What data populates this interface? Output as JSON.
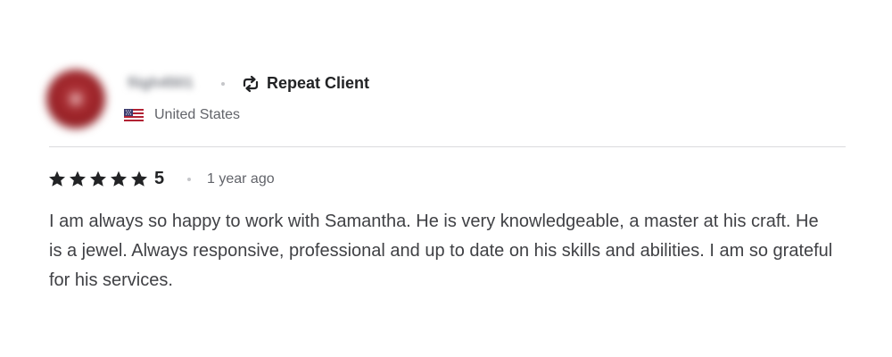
{
  "review": {
    "reviewer": {
      "username": "fiigh4501",
      "avatar_color": "#9a2227",
      "badge_label": "Repeat Client",
      "badge_icon": "repeat-icon",
      "country": "United States",
      "country_icon": "us-flag-icon"
    },
    "rating": {
      "stars": 5,
      "max_stars": 5,
      "score_label": "5",
      "star_color": "#222325",
      "star_icon": "star-icon"
    },
    "time_ago": "1 year ago",
    "text": "I am always so happy to work with Samantha. He is very knowledgeable, a master at his craft. He is a jewel. Always responsive, professional and up to date on his skills and abilities. I am so grateful for his services."
  }
}
